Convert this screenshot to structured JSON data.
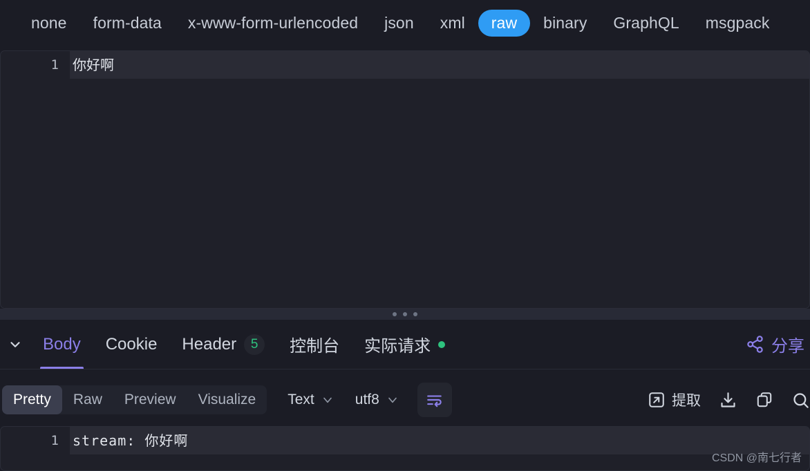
{
  "body_type_tabs": [
    {
      "label": "none",
      "active": false
    },
    {
      "label": "form-data",
      "active": false
    },
    {
      "label": "x-www-form-urlencoded",
      "active": false
    },
    {
      "label": "json",
      "active": false
    },
    {
      "label": "xml",
      "active": false
    },
    {
      "label": "raw",
      "active": true
    },
    {
      "label": "binary",
      "active": false
    },
    {
      "label": "GraphQL",
      "active": false
    },
    {
      "label": "msgpack",
      "active": false
    }
  ],
  "request_editor": {
    "line_number": "1",
    "content": "你好啊"
  },
  "response_tabs": [
    {
      "label": "Body",
      "active": true,
      "badge": null,
      "dot": false
    },
    {
      "label": "Cookie",
      "active": false,
      "badge": null,
      "dot": false
    },
    {
      "label": "Header",
      "active": false,
      "badge": "5",
      "dot": false
    },
    {
      "label": "控制台",
      "active": false,
      "badge": null,
      "dot": false
    },
    {
      "label": "实际请求",
      "active": false,
      "badge": null,
      "dot": true
    }
  ],
  "share": {
    "label": "分享",
    "icon": "share-icon"
  },
  "toolbar": {
    "view_modes": [
      {
        "label": "Pretty",
        "active": true
      },
      {
        "label": "Raw",
        "active": false
      },
      {
        "label": "Preview",
        "active": false
      },
      {
        "label": "Visualize",
        "active": false
      }
    ],
    "format_select": {
      "value": "Text",
      "icon": "chevron-down-icon"
    },
    "encoding_select": {
      "value": "utf8",
      "icon": "chevron-down-icon"
    },
    "wrap_toggle": {
      "icon": "word-wrap-icon",
      "active": true
    },
    "actions": [
      {
        "label": "提取",
        "icon": "extract-icon"
      },
      {
        "label": "",
        "icon": "download-icon"
      },
      {
        "label": "",
        "icon": "copy-icon"
      },
      {
        "label": "",
        "icon": "search-icon"
      }
    ]
  },
  "response_body": {
    "line_number": "1",
    "content": "stream: 你好啊"
  },
  "watermark": "CSDN @南七行者",
  "colors": {
    "accent_blue": "#2f9cf4",
    "accent_purple": "#8b7fe8",
    "status_green": "#2ec27e",
    "background": "#1b1c25",
    "panel": "#1f2029"
  }
}
